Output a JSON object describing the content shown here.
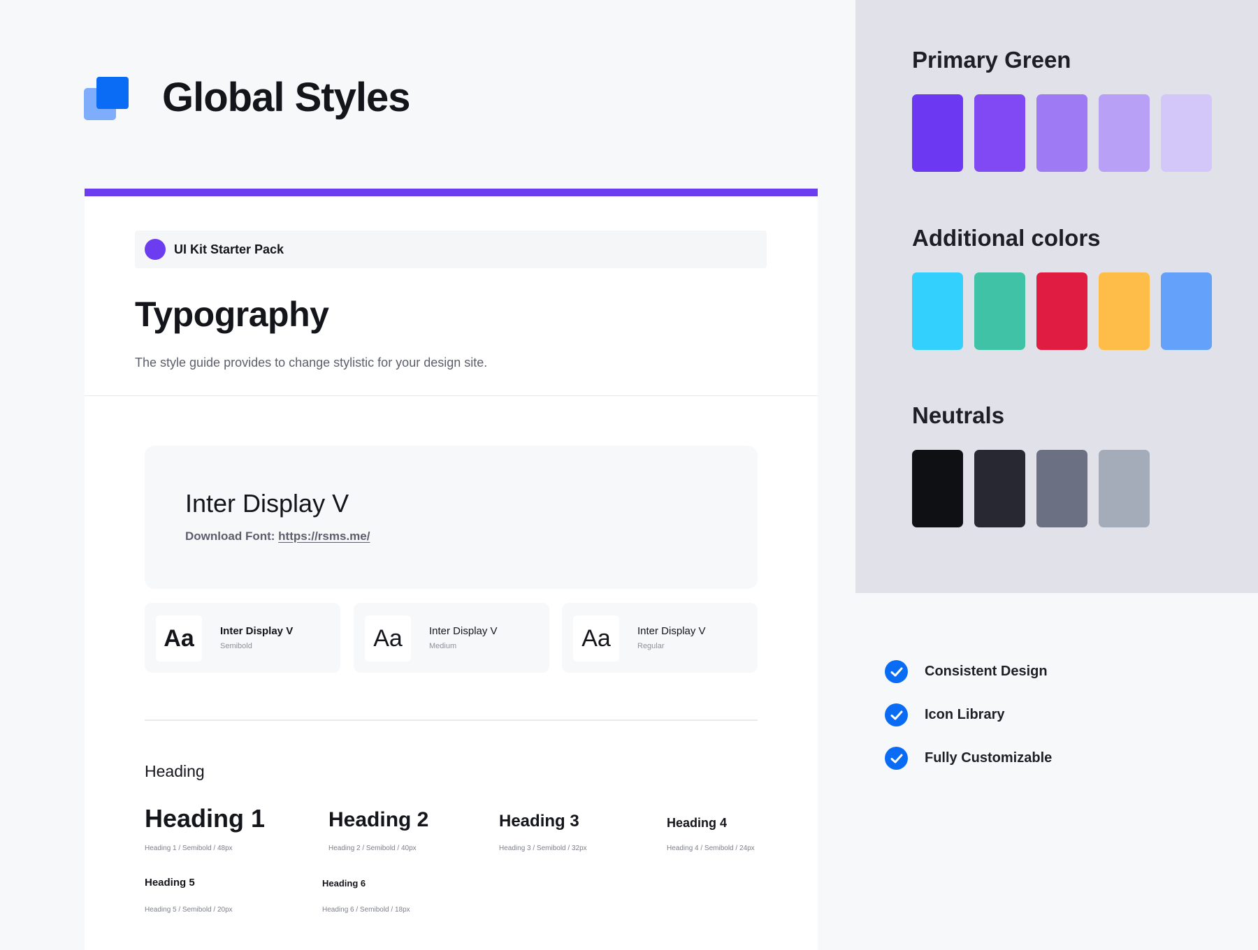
{
  "header": {
    "title": "Global Styles"
  },
  "kit": {
    "label": "UI Kit Starter Pack",
    "dot_color": "#6c3cf0"
  },
  "typography": {
    "title": "Typography",
    "description": "The style guide provides to change stylistic for your design site."
  },
  "font": {
    "name": "Inter Display V",
    "download_label": "Download Font:",
    "download_link": "https://rsms.me/"
  },
  "weights": [
    {
      "sample": "Aa",
      "name": "Inter Display V",
      "weight": "Semibold"
    },
    {
      "sample": "Aa",
      "name": "Inter Display V",
      "weight": "Medium"
    },
    {
      "sample": "Aa",
      "name": "Inter Display V",
      "weight": "Regular"
    }
  ],
  "headings": {
    "section_label": "Heading",
    "items": [
      {
        "label": "Heading 1",
        "spec": "Heading 1 / Semibold / 48px"
      },
      {
        "label": "Heading 2",
        "spec": "Heading 2 / Semibold / 40px"
      },
      {
        "label": "Heading 3",
        "spec": "Heading 3 / Semibold / 32px"
      },
      {
        "label": "Heading 4",
        "spec": "Heading 4 / Semibold / 24px"
      },
      {
        "label": "Heading 5",
        "spec": "Heading 5 / Semibold / 20px"
      },
      {
        "label": "Heading 6",
        "spec": "Heading 6 / Semibold / 18px"
      }
    ]
  },
  "palettes": {
    "primary": {
      "title": "Primary Green",
      "colors": [
        "#6d38f2",
        "#8049f3",
        "#9e7af4",
        "#b8a0f6",
        "#d3c6f8"
      ]
    },
    "additional": {
      "title": "Additional colors",
      "colors": [
        "#33cffd",
        "#3fc2a5",
        "#e01c43",
        "#fdbd48",
        "#64a1fa"
      ]
    },
    "neutrals": {
      "title": "Neutrals",
      "colors": [
        "#0f1014",
        "#272831",
        "#6b7083",
        "#a4acb9"
      ]
    }
  },
  "features": [
    {
      "icon": "check-circle-icon",
      "label": "Consistent Design"
    },
    {
      "icon": "check-circle-icon",
      "label": "Icon Library"
    },
    {
      "icon": "check-circle-icon",
      "label": "Fully Customizable"
    }
  ],
  "colors": {
    "accent": "#6c3cf0",
    "brand_blue": "#0a6cf5"
  }
}
